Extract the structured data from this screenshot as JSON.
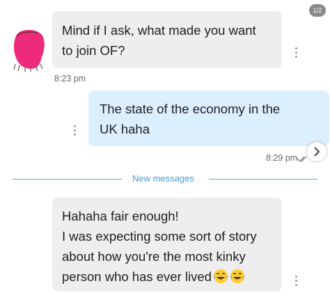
{
  "page_indicator": "1/2",
  "messages": [
    {
      "direction": "incoming",
      "text_lines": [
        "Mind if I ask, what made you want",
        "to join OF?"
      ],
      "time": "8:23 pm"
    },
    {
      "direction": "outgoing",
      "text_lines": [
        "The state of the economy in the",
        "UK haha"
      ],
      "time": "8:29 pm"
    },
    {
      "direction": "incoming",
      "text_lines": [
        "Hahaha fair enough!",
        "I was expecting some sort of story",
        "about how you're the most kinky",
        "person who has ever lived"
      ],
      "emojis": [
        "face-with-tears-of-joy",
        "face-with-tears-of-joy"
      ]
    }
  ],
  "divider": {
    "label": "New messages"
  },
  "colors": {
    "incoming_bubble": "#eeeeee",
    "outgoing_bubble": "#dcefff",
    "divider": "#5aa7d8",
    "avatar": "#ee2b7a"
  }
}
